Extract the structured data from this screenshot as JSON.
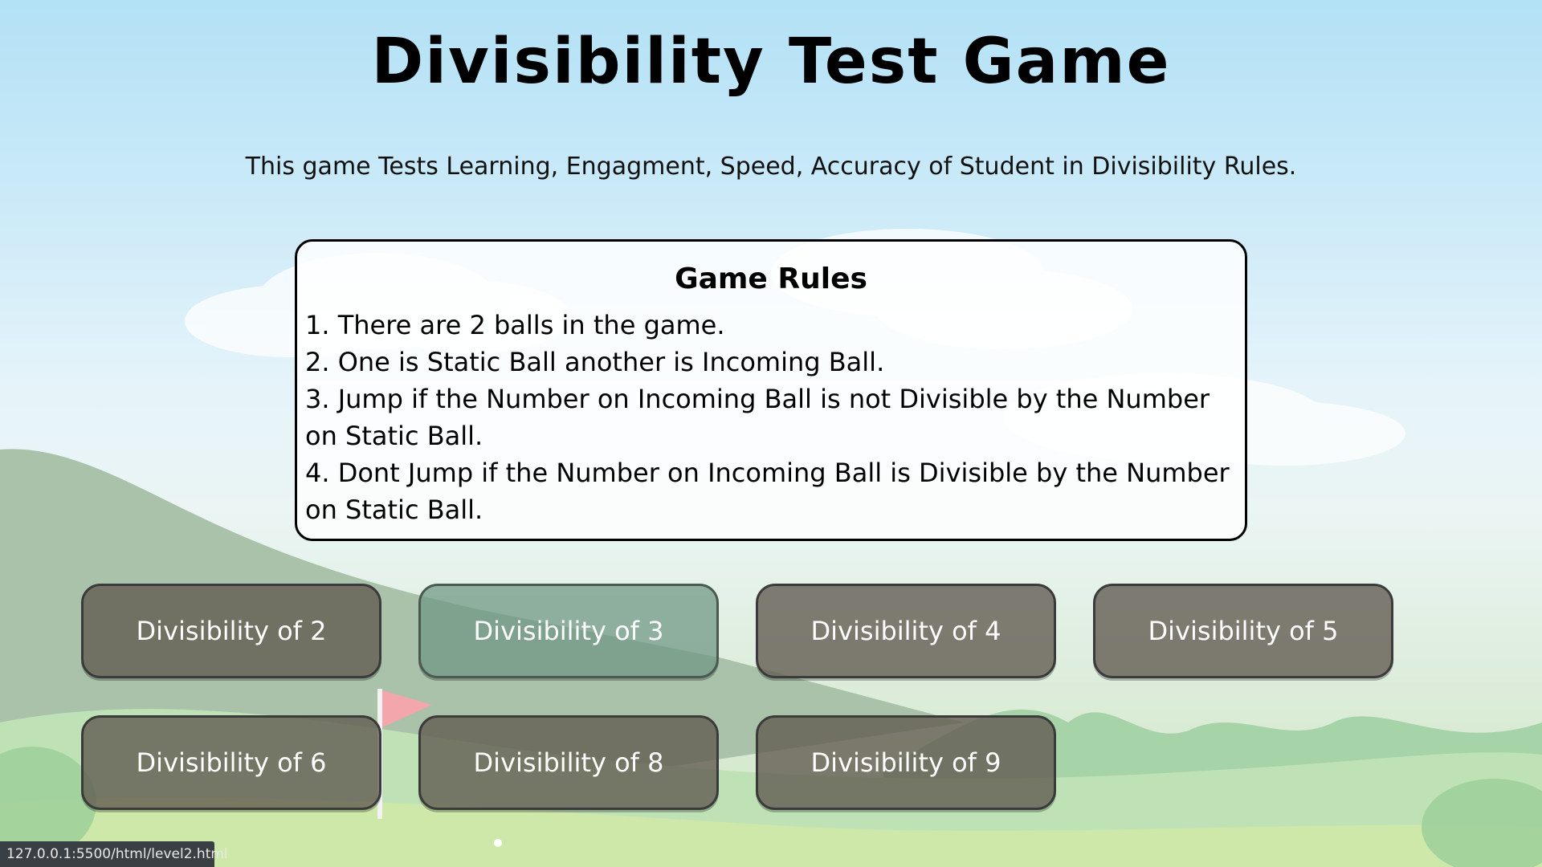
{
  "header": {
    "title": "Divisibility Test Game",
    "subtitle": "This game Tests Learning, Engagment, Speed, Accuracy of Student in Divisibility Rules."
  },
  "rules": {
    "heading": "Game Rules",
    "items": [
      "1. There are 2 balls in the game.",
      "2. One is Static Ball another is Incoming Ball.",
      "3. Jump if the Number on Incoming Ball is not Divisible by the Number on Static Ball.",
      "4. Dont Jump if the Number on Incoming Ball is Divisible by the Number on Static Ball."
    ]
  },
  "levels": [
    {
      "label": "Divisibility of 2",
      "icon": "level-2-button"
    },
    {
      "label": "Divisibility of 3",
      "icon": "level-3-button"
    },
    {
      "label": "Divisibility of 4",
      "icon": "level-4-button"
    },
    {
      "label": "Divisibility of 5",
      "icon": "level-5-button"
    },
    {
      "label": "Divisibility of 6",
      "icon": "level-6-button"
    },
    {
      "label": "Divisibility of 8",
      "icon": "level-8-button"
    },
    {
      "label": "Divisibility of 9",
      "icon": "level-9-button"
    }
  ],
  "status_bar": {
    "url": "127.0.0.1:5500/html/level2.html"
  },
  "colors": {
    "button_bg": "#605850",
    "button_hover_bg": "#6e9682",
    "text": "#000000"
  }
}
